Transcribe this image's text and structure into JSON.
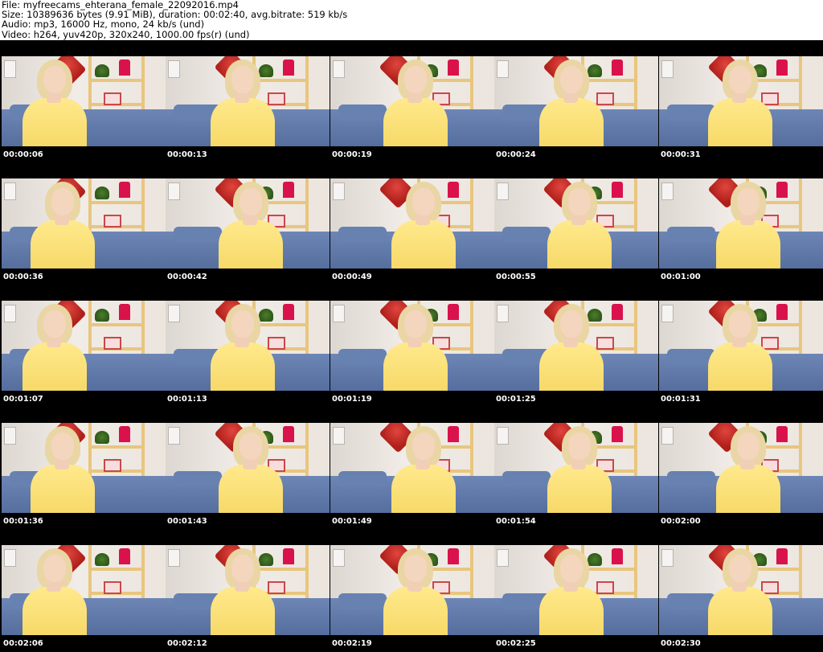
{
  "header": {
    "file_line": "File: myfreecams_ehterana_female_22092016.mp4",
    "size_line": "Size: 10389636 bytes (9.91 MiB), duration: 00:02:40, avg.bitrate: 519 kb/s",
    "audio_line": "Audio: mp3, 16000 Hz, mono, 24 kb/s (und)",
    "video_line": "Video: h264, yuv420p, 320x240, 1000.00 fps(r) (und)"
  },
  "thumbnails": [
    {
      "timestamp": "00:00:06"
    },
    {
      "timestamp": "00:00:13"
    },
    {
      "timestamp": "00:00:19"
    },
    {
      "timestamp": "00:00:24"
    },
    {
      "timestamp": "00:00:31"
    },
    {
      "timestamp": "00:00:36"
    },
    {
      "timestamp": "00:00:42"
    },
    {
      "timestamp": "00:00:49"
    },
    {
      "timestamp": "00:00:55"
    },
    {
      "timestamp": "00:01:00"
    },
    {
      "timestamp": "00:01:07"
    },
    {
      "timestamp": "00:01:13"
    },
    {
      "timestamp": "00:01:19"
    },
    {
      "timestamp": "00:01:25"
    },
    {
      "timestamp": "00:01:31"
    },
    {
      "timestamp": "00:01:36"
    },
    {
      "timestamp": "00:01:43"
    },
    {
      "timestamp": "00:01:49"
    },
    {
      "timestamp": "00:01:54"
    },
    {
      "timestamp": "00:02:00"
    },
    {
      "timestamp": "00:02:06"
    },
    {
      "timestamp": "00:02:12"
    },
    {
      "timestamp": "00:02:19"
    },
    {
      "timestamp": "00:02:25"
    },
    {
      "timestamp": "00:02:30"
    }
  ]
}
